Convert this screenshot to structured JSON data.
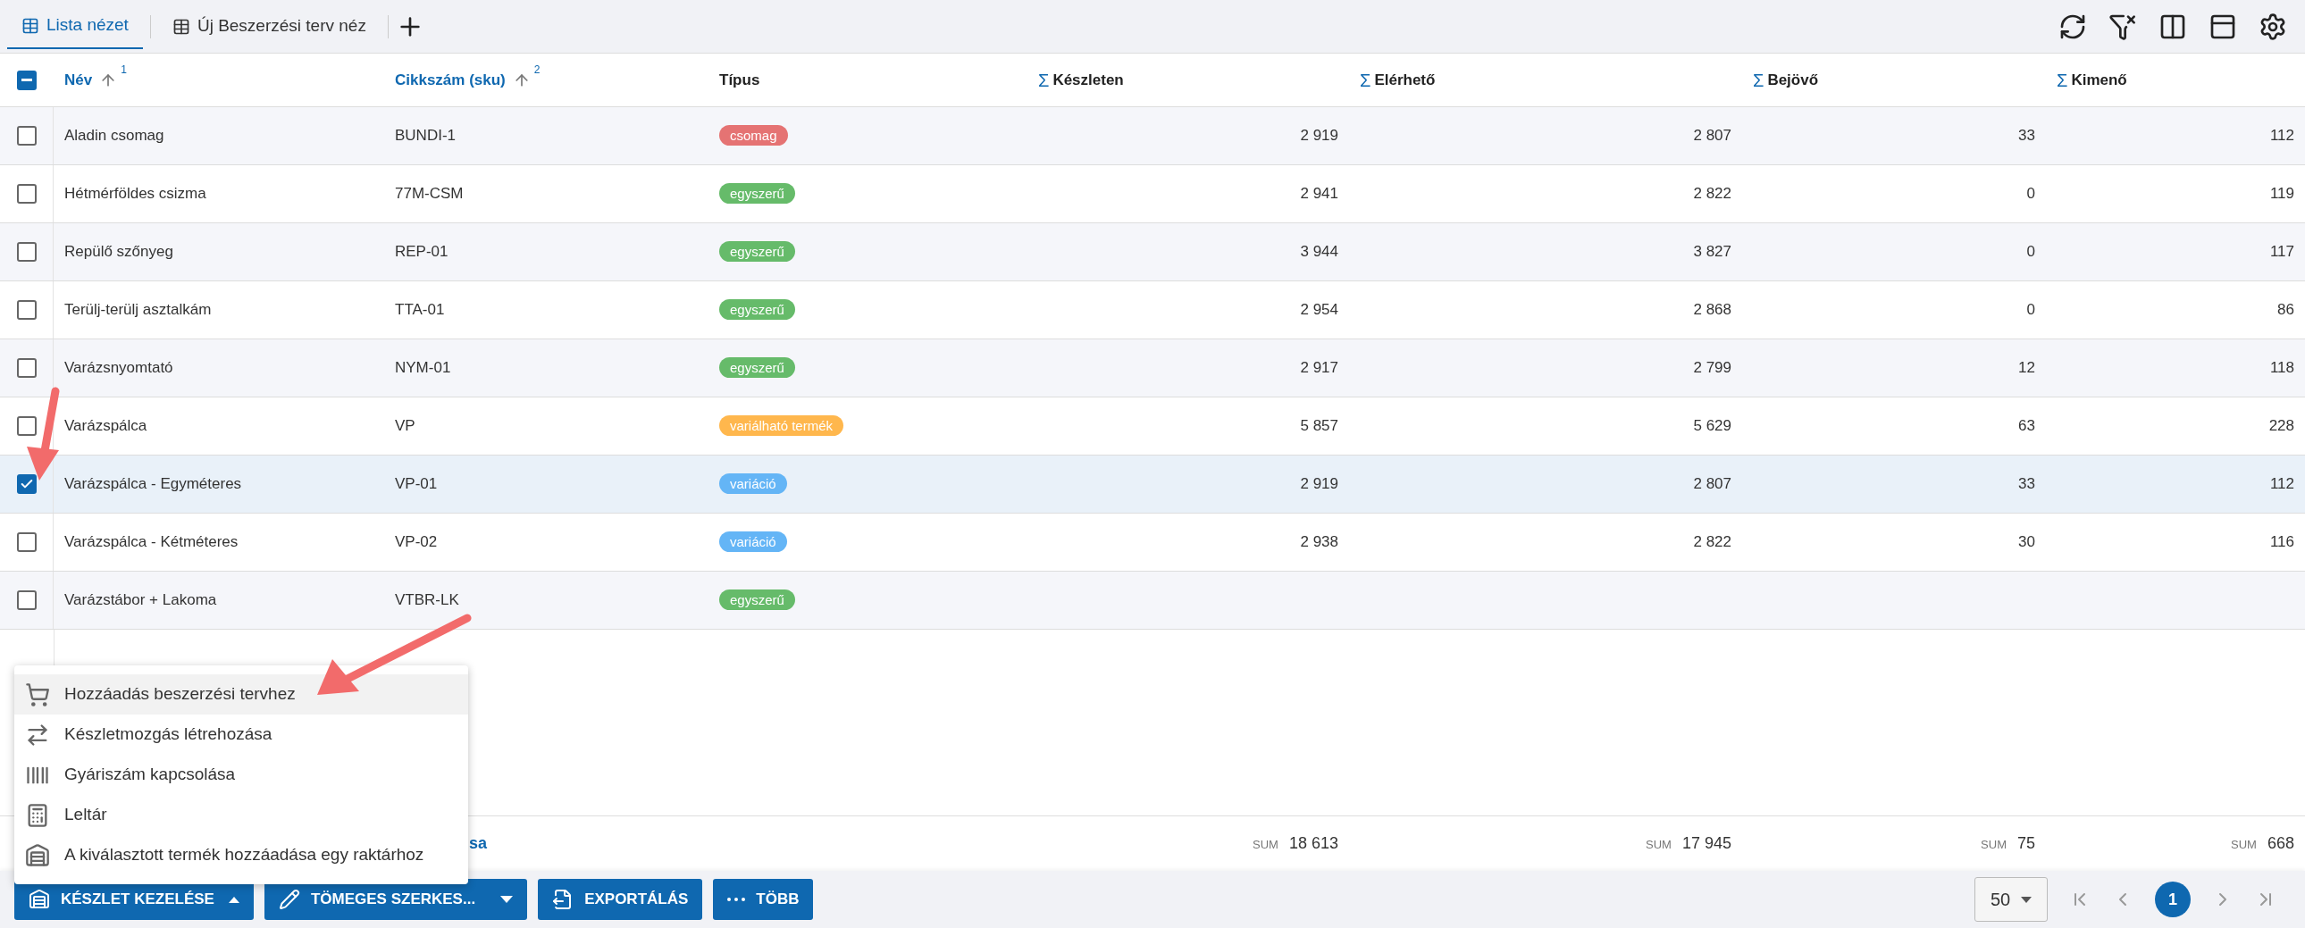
{
  "tabs": [
    {
      "label": "Lista nézet",
      "selected": true
    },
    {
      "label": "Új Beszerzési terv néz",
      "selected": false
    }
  ],
  "table": {
    "select_all": {
      "indeterminate": true
    },
    "columns": [
      {
        "label": "Név",
        "kind": "sort",
        "order": "1"
      },
      {
        "label": "Cikkszám (sku)",
        "kind": "sort",
        "order": "2"
      },
      {
        "label": "Típus",
        "kind": "plain"
      },
      {
        "label": "Készleten",
        "kind": "sum",
        "sign": "Σ"
      },
      {
        "label": "Elérhető",
        "kind": "sum",
        "sign": "Σ"
      },
      {
        "label": "Bejövő",
        "kind": "sum",
        "sign": "Σ"
      },
      {
        "label": "Kimenő",
        "kind": "sum",
        "sign": "Σ"
      }
    ],
    "rows": [
      {
        "selected": false,
        "name": "Aladin csomag",
        "sku": "BUNDI-1",
        "type": "csomag",
        "color": "#e57373",
        "stock": "2 919",
        "available": "2 807",
        "incoming": "33",
        "outgoing": "112"
      },
      {
        "selected": false,
        "name": "Hétmérföldes csizma",
        "sku": "77M-CSM",
        "type": "egyszerű",
        "color": "#66bb6a",
        "stock": "2 941",
        "available": "2 822",
        "incoming": "0",
        "outgoing": "119"
      },
      {
        "selected": false,
        "name": "Repülő szőnyeg",
        "sku": "REP-01",
        "type": "egyszerű",
        "color": "#66bb6a",
        "stock": "3 944",
        "available": "3 827",
        "incoming": "0",
        "outgoing": "117"
      },
      {
        "selected": false,
        "name": "Terülj-terülj asztalkám",
        "sku": "TTA-01",
        "type": "egyszerű",
        "color": "#66bb6a",
        "stock": "2 954",
        "available": "2 868",
        "incoming": "0",
        "outgoing": "86"
      },
      {
        "selected": false,
        "name": "Varázsnyomtató",
        "sku": "NYM-01",
        "type": "egyszerű",
        "color": "#66bb6a",
        "stock": "2 917",
        "available": "2 799",
        "incoming": "12",
        "outgoing": "118"
      },
      {
        "selected": false,
        "name": "Varázspálca",
        "sku": "VP",
        "type": "variálható termék",
        "color": "#ffb74d",
        "stock": "5 857",
        "available": "5 629",
        "incoming": "63",
        "outgoing": "228"
      },
      {
        "selected": true,
        "name": "Varázspálca - Egyméteres",
        "sku": "VP-01",
        "type": "variáció",
        "color": "#64b5f6",
        "stock": "2 919",
        "available": "2 807",
        "incoming": "33",
        "outgoing": "112"
      },
      {
        "selected": false,
        "name": "Varázspálca - Kétméteres",
        "sku": "VP-02",
        "type": "variáció",
        "color": "#64b5f6",
        "stock": "2 938",
        "available": "2 822",
        "incoming": "30",
        "outgoing": "116"
      },
      {
        "selected": false,
        "name": "Varázstábor + Lakoma",
        "sku": "VTBR-LK",
        "type": "egyszerű",
        "color": "#66bb6a"
      }
    ],
    "footer": {
      "label": "sa",
      "sums": [
        {
          "tag": "SUM",
          "value": "18 613"
        },
        {
          "tag": "SUM",
          "value": "17 945"
        },
        {
          "tag": "SUM",
          "value": "75"
        },
        {
          "tag": "SUM",
          "value": "668"
        }
      ]
    }
  },
  "menu": {
    "items": [
      {
        "label": "Hozzáadás beszerzési tervhez",
        "selected": true
      },
      {
        "label": "Készletmozgás létrehozása",
        "selected": false
      },
      {
        "label": "Gyáriszám kapcsolása",
        "selected": false
      },
      {
        "label": "Leltár",
        "selected": false
      },
      {
        "label": "A kiválasztott termék hozzáadása egy raktárhoz",
        "selected": false
      }
    ]
  },
  "actions": [
    {
      "label": "KÉSZLET KEZELÉSE",
      "kind": "dropdown",
      "expanded": true
    },
    {
      "label": "TÖMEGES SZERKES...",
      "kind": "dropdown",
      "expanded": false
    },
    {
      "label": "EXPORTÁLÁS",
      "kind": "plain"
    },
    {
      "label": "TÖBB",
      "kind": "plain"
    }
  ],
  "pagination": {
    "page_size": "50",
    "pages": [
      {
        "label": "1",
        "selected": true
      }
    ]
  }
}
